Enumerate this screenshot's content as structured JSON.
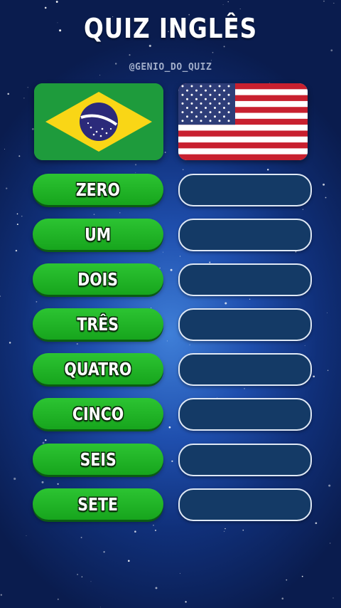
{
  "header": {
    "title": "QUIZ INGLÊS",
    "handle": "@GENIO_DO_QUIZ"
  },
  "flags": {
    "left_icon": "brazil-flag-icon",
    "right_icon": "usa-flag-icon"
  },
  "words": [
    {
      "portuguese": "ZERO",
      "english": ""
    },
    {
      "portuguese": "UM",
      "english": ""
    },
    {
      "portuguese": "DOIS",
      "english": ""
    },
    {
      "portuguese": "TRÊS",
      "english": ""
    },
    {
      "portuguese": "QUATRO",
      "english": ""
    },
    {
      "portuguese": "CINCO",
      "english": ""
    },
    {
      "portuguese": "SEIS",
      "english": ""
    },
    {
      "portuguese": "SETE",
      "english": ""
    }
  ],
  "colors": {
    "background": "#1f4fae",
    "left_pill": "#1fb526",
    "right_box": "#143a66",
    "right_border": "#dfe8f5"
  }
}
